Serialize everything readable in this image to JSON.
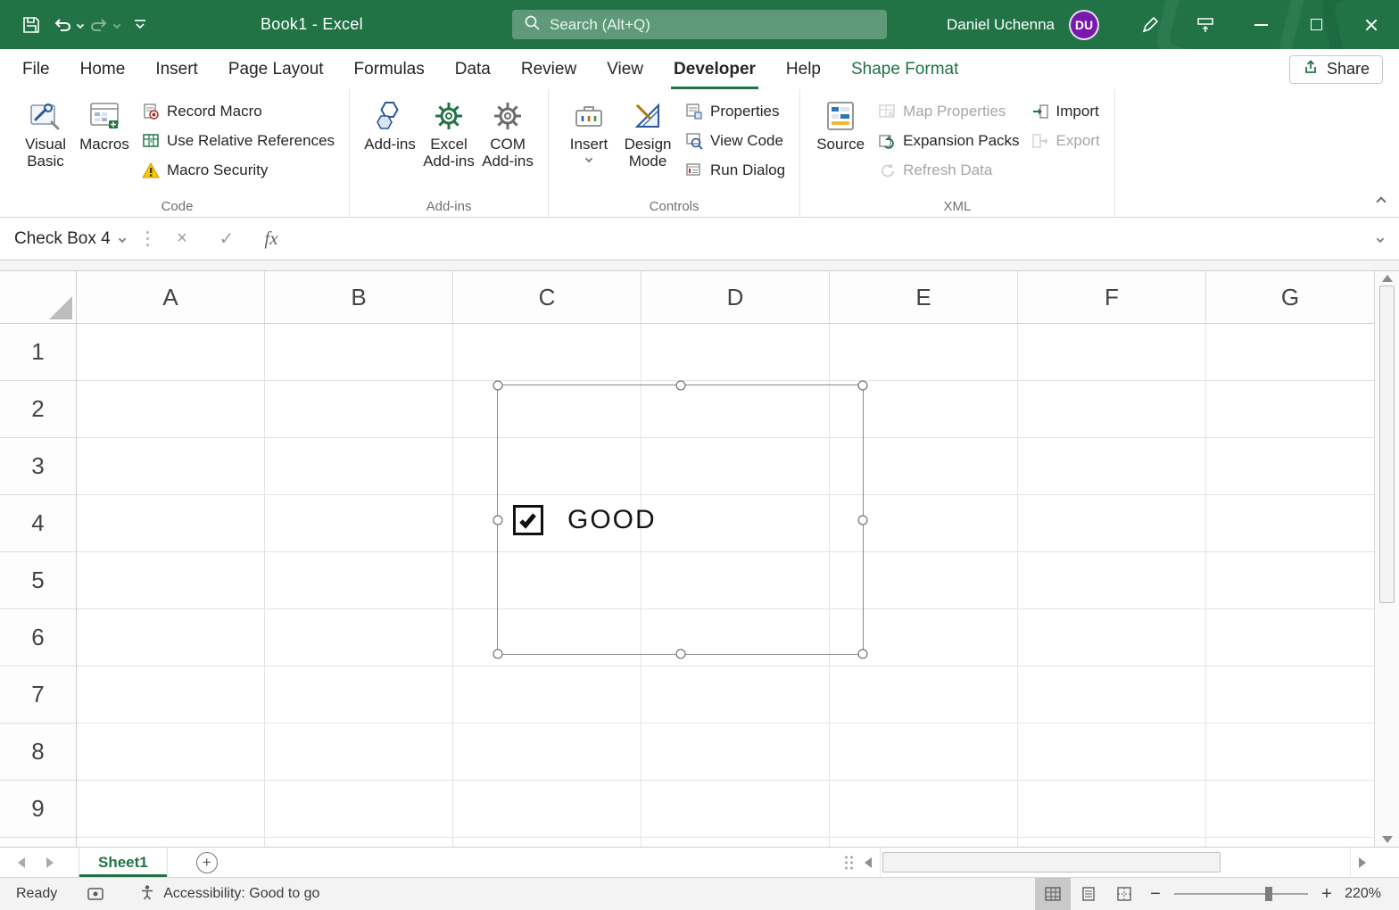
{
  "titlebar": {
    "title": "Book1 - Excel",
    "search_placeholder": "Search (Alt+Q)",
    "user_name": "Daniel Uchenna",
    "user_initials": "DU"
  },
  "tabs": {
    "items": [
      "File",
      "Home",
      "Insert",
      "Page Layout",
      "Formulas",
      "Data",
      "Review",
      "View",
      "Developer",
      "Help",
      "Shape Format"
    ],
    "active": "Developer",
    "contextual": "Shape Format",
    "share": "Share"
  },
  "ribbon": {
    "code": {
      "label": "Code",
      "visual_basic": "Visual Basic",
      "macros": "Macros",
      "record_macro": "Record Macro",
      "use_relative_references": "Use Relative References",
      "macro_security": "Macro Security"
    },
    "addins": {
      "label": "Add-ins",
      "add_ins": "Add-ins",
      "excel_add_ins": "Excel Add-ins",
      "com_add_ins": "COM Add-ins"
    },
    "controls": {
      "label": "Controls",
      "insert": "Insert",
      "design_mode": "Design Mode",
      "properties": "Properties",
      "view_code": "View Code",
      "run_dialog": "Run Dialog"
    },
    "xml": {
      "label": "XML",
      "source": "Source",
      "map_properties": "Map Properties",
      "expansion_packs": "Expansion Packs",
      "refresh_data": "Refresh Data",
      "import": "Import",
      "export": "Export"
    }
  },
  "formula_bar": {
    "name_box": "Check Box 4",
    "cancel": "×",
    "enter": "✓",
    "fx": "fx"
  },
  "grid": {
    "columns": [
      "A",
      "B",
      "C",
      "D",
      "E",
      "F",
      "G"
    ],
    "rows": [
      "1",
      "2",
      "3",
      "4",
      "5",
      "6",
      "7",
      "8",
      "9"
    ],
    "checkbox_label": "GOOD",
    "checkbox_checked": true
  },
  "sheet_bar": {
    "active_tab": "Sheet1",
    "add_sheet": "+"
  },
  "status_bar": {
    "ready": "Ready",
    "accessibility": "Accessibility: Good to go",
    "zoom_minus": "−",
    "zoom_plus": "+",
    "zoom_level": "220%"
  },
  "colors": {
    "excel_green": "#217346",
    "avatar_purple": "#7719aa",
    "disabled_gray": "#a6a6a6",
    "warning_yellow": "#fbca00",
    "record_red": "#b02b2b",
    "addin_blue": "#2b579a"
  }
}
